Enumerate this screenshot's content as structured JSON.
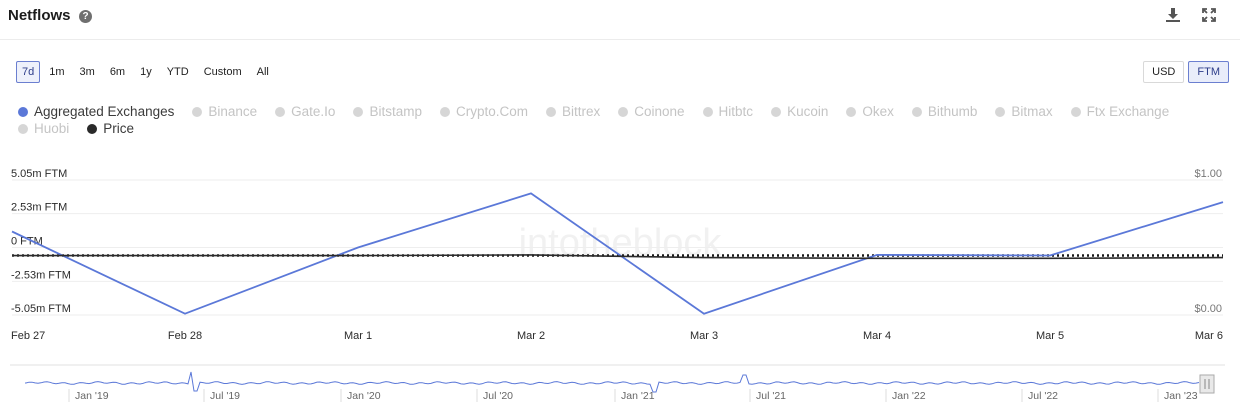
{
  "header": {
    "title": "Netflows",
    "help_icon": "question-circle-icon",
    "download_icon": "download-icon",
    "expand_icon": "expand-icon"
  },
  "ranges": [
    {
      "label": "7d",
      "active": true
    },
    {
      "label": "1m",
      "active": false
    },
    {
      "label": "3m",
      "active": false
    },
    {
      "label": "6m",
      "active": false
    },
    {
      "label": "1y",
      "active": false
    },
    {
      "label": "YTD",
      "active": false
    },
    {
      "label": "Custom",
      "active": false
    },
    {
      "label": "All",
      "active": false
    }
  ],
  "currency": [
    {
      "label": "USD",
      "active": false
    },
    {
      "label": "FTM",
      "active": true
    }
  ],
  "colors": {
    "accent": "#5b78d8",
    "price": "#2a2a2a",
    "inactive": "#d6d6d6",
    "grid": "#eeeeee"
  },
  "chart_data": {
    "type": "line",
    "watermark": "intotheblock",
    "x": [
      "Feb 27",
      "Feb 28",
      "Mar 1",
      "Mar 2",
      "Mar 3",
      "Mar 4",
      "Mar 5",
      "Mar 6"
    ],
    "series": [
      {
        "name": "Aggregated Exchanges",
        "axis": "left",
        "color": "#5b78d8",
        "active": true,
        "values": [
          1.2,
          -4.95,
          0.0,
          4.05,
          -4.95,
          -0.55,
          -0.6,
          3.4
        ]
      },
      {
        "name": "Binance",
        "active": false
      },
      {
        "name": "Gate.Io",
        "active": false
      },
      {
        "name": "Bitstamp",
        "active": false
      },
      {
        "name": "Crypto.Com",
        "active": false
      },
      {
        "name": "Bittrex",
        "active": false
      },
      {
        "name": "Coinone",
        "active": false
      },
      {
        "name": "Hitbtc",
        "active": false
      },
      {
        "name": "Kucoin",
        "active": false
      },
      {
        "name": "Okex",
        "active": false
      },
      {
        "name": "Bithumb",
        "active": false
      },
      {
        "name": "Bitmax",
        "active": false
      },
      {
        "name": "Ftx Exchange",
        "active": false
      },
      {
        "name": "Huobi",
        "active": false
      },
      {
        "name": "Price",
        "axis": "right",
        "color": "#2a2a2a",
        "active": true,
        "values": [
          0.44,
          0.44,
          0.44,
          0.445,
          0.425,
          0.42,
          0.42,
          0.425
        ]
      }
    ],
    "yleft": {
      "ticks": [
        "5.05m FTM",
        "2.53m FTM",
        "0 FTM",
        "-2.53m FTM",
        "-5.05m FTM"
      ],
      "tick_values": [
        5.05,
        2.53,
        0,
        -2.53,
        -5.05
      ],
      "ylim": [
        -5.05,
        5.05
      ]
    },
    "yright": {
      "ticks": [
        "$1.00",
        "$0.00"
      ],
      "tick_values": [
        1.0,
        0.0
      ],
      "ylim": [
        0,
        1
      ]
    },
    "zero_line": "dotted",
    "grid": true,
    "legend": "top-left",
    "navigator": {
      "labels": [
        "Jan '19",
        "Jul '19",
        "Jan '20",
        "Jul '20",
        "Jan '21",
        "Jul '21",
        "Jan '22",
        "Jul '22",
        "Jan '23"
      ]
    }
  }
}
